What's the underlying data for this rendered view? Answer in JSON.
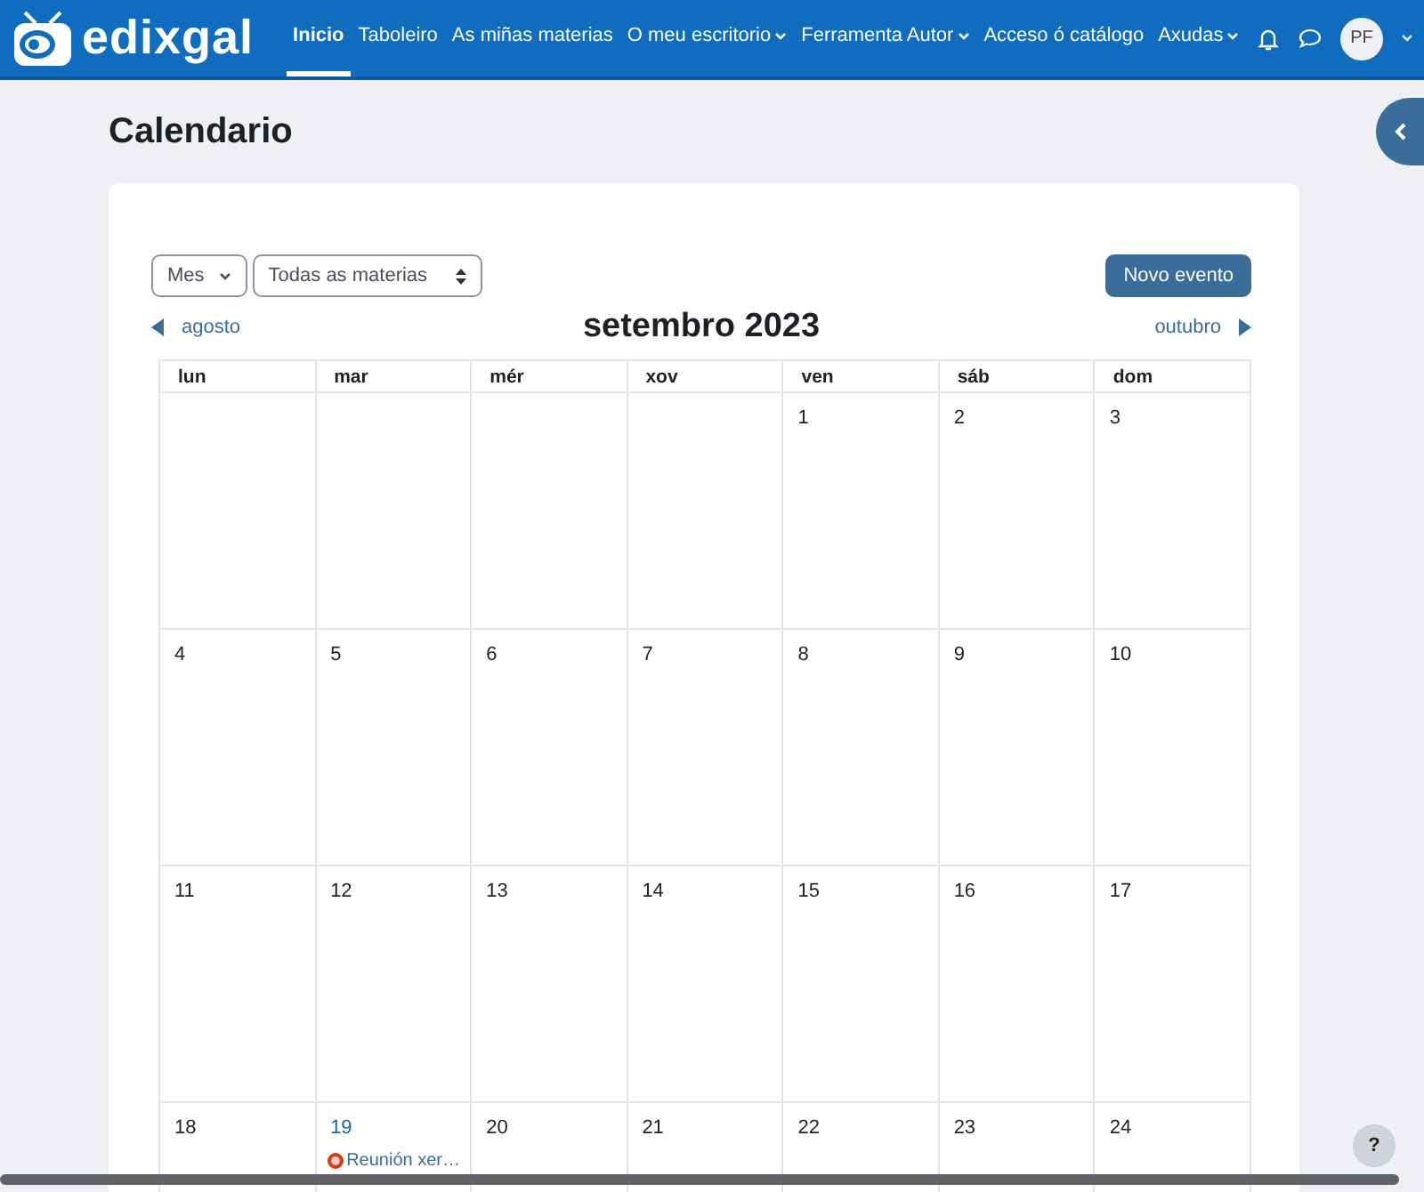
{
  "navbar": {
    "logo": "edixgal",
    "items": [
      {
        "label": "Inicio",
        "selected": true,
        "has_menu": false
      },
      {
        "label": "Taboleiro",
        "selected": false,
        "has_menu": false
      },
      {
        "label": "As miñas materias",
        "selected": false,
        "has_menu": false
      },
      {
        "label": "O meu escritorio",
        "selected": false,
        "has_menu": true
      },
      {
        "label": "Ferramenta Autor",
        "selected": false,
        "has_menu": true
      },
      {
        "label": "Acceso ó catálogo",
        "selected": false,
        "has_menu": false
      },
      {
        "label": "Axudas",
        "selected": false,
        "has_menu": true
      }
    ],
    "avatar": "PF"
  },
  "page_title": "Calendario",
  "view_select": {
    "value": "Mes"
  },
  "course_select": {
    "value": "Todas as materias"
  },
  "new_event_button": "Novo evento",
  "prev_month": "agosto",
  "month_title": "setembro 2023",
  "next_month": "outubro",
  "weekdays": [
    "lun",
    "mar",
    "mér",
    "xov",
    "ven",
    "sáb",
    "dom"
  ],
  "weeks": [
    [
      {
        "kind": "blank"
      },
      {
        "kind": "blank"
      },
      {
        "kind": "blank"
      },
      {
        "kind": "blank"
      },
      {
        "kind": "day",
        "day": "1",
        "today": false
      },
      {
        "kind": "day",
        "day": "2",
        "today": false
      },
      {
        "kind": "day",
        "day": "3",
        "today": false
      }
    ],
    [
      {
        "kind": "day",
        "day": "4",
        "today": false
      },
      {
        "kind": "day",
        "day": "5",
        "today": false
      },
      {
        "kind": "day",
        "day": "6",
        "today": false
      },
      {
        "kind": "day",
        "day": "7",
        "today": false
      },
      {
        "kind": "day",
        "day": "8",
        "today": false
      },
      {
        "kind": "day",
        "day": "9",
        "today": false
      },
      {
        "kind": "day",
        "day": "10",
        "today": false
      }
    ],
    [
      {
        "kind": "day",
        "day": "11",
        "today": false
      },
      {
        "kind": "day",
        "day": "12",
        "today": false
      },
      {
        "kind": "day",
        "day": "13",
        "today": false
      },
      {
        "kind": "day",
        "day": "14",
        "today": false
      },
      {
        "kind": "day",
        "day": "15",
        "today": false
      },
      {
        "kind": "day",
        "day": "16",
        "today": false
      },
      {
        "kind": "day",
        "day": "17",
        "today": false
      }
    ],
    [
      {
        "kind": "day",
        "day": "18",
        "today": false
      },
      {
        "kind": "day",
        "day": "19",
        "today": true,
        "events": [
          {
            "title": "Reunión xer…",
            "color": "#d83a10"
          }
        ]
      },
      {
        "kind": "day",
        "day": "20",
        "today": false
      },
      {
        "kind": "day",
        "day": "21",
        "today": false
      },
      {
        "kind": "day",
        "day": "22",
        "today": false
      },
      {
        "kind": "day",
        "day": "23",
        "today": false
      },
      {
        "kind": "day",
        "day": "24",
        "today": false
      }
    ]
  ],
  "help_button": "?"
}
